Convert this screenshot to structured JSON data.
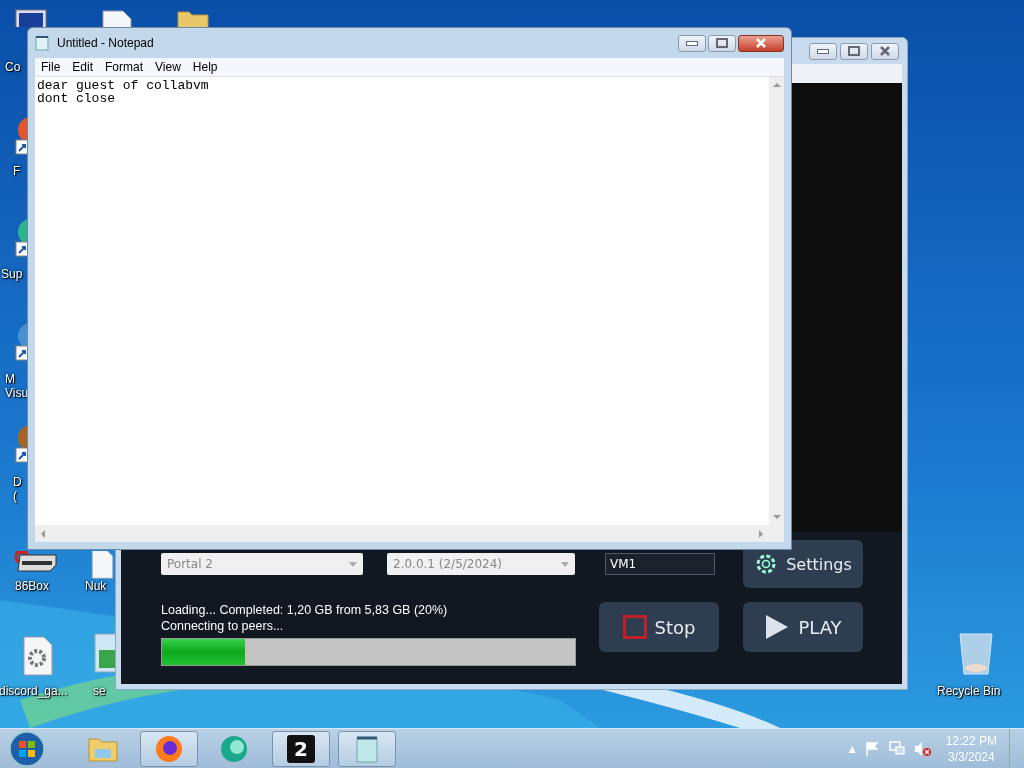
{
  "desktop": {
    "icons": [
      {
        "kind": "computer",
        "label_lines": [
          "Co"
        ]
      },
      {
        "kind": "file"
      },
      {
        "kind": "folder"
      },
      {
        "kind": "shortcut",
        "color": "#e8552a",
        "label_lines": [
          "F"
        ]
      },
      {
        "kind": "shortcut",
        "color": "#2fb58a",
        "label_lines": [
          "Sup"
        ]
      },
      {
        "kind": "shortcut",
        "color": "#4a8fd0",
        "label_lines": [
          "M",
          "Visu"
        ]
      },
      {
        "kind": "shortcut",
        "color": "#a8641e",
        "label_lines": [
          "D",
          "("
        ]
      },
      {
        "kind": "emulator",
        "label_lines": [
          "86Box"
        ]
      },
      {
        "kind": "file",
        "label_lines": [
          "Nuk"
        ]
      },
      {
        "kind": "gear-file",
        "label_lines": [
          "discord_ga..."
        ]
      },
      {
        "kind": "installer",
        "label_lines": [
          "se"
        ]
      },
      {
        "kind": "recycle-bin",
        "label_lines": [
          "Recycle Bin"
        ]
      }
    ]
  },
  "launcher": {
    "game_select": {
      "value": "Portal 2",
      "disabled": true
    },
    "version_select": {
      "value": "2.0.0.1 (2/5/2024)",
      "disabled": true
    },
    "name_field": {
      "value": "VM1"
    },
    "settings_button": "Settings",
    "status_lines": [
      "Loading... Completed: 1,20 GB from 5,83 GB (20%)",
      "Connecting to peers..."
    ],
    "progress": {
      "level": 0.2
    },
    "stop_button": "Stop",
    "play_button": "PLAY"
  },
  "notepad": {
    "title": "Untitled - Notepad",
    "menu": [
      "File",
      "Edit",
      "Format",
      "View",
      "Help"
    ],
    "lines": [
      "dear guest of collabvm",
      "dont close"
    ]
  },
  "taskbar": {
    "items": [
      {
        "kind": "explorer",
        "running": false
      },
      {
        "kind": "firefox",
        "running": true
      },
      {
        "kind": "green-app",
        "running": false
      },
      {
        "kind": "badge-app",
        "glyph": "2",
        "running": true
      },
      {
        "kind": "notepad",
        "running": true
      }
    ],
    "tray": {
      "chevron": "▲",
      "time": "12:22 PM",
      "date": "3/3/2024"
    }
  }
}
